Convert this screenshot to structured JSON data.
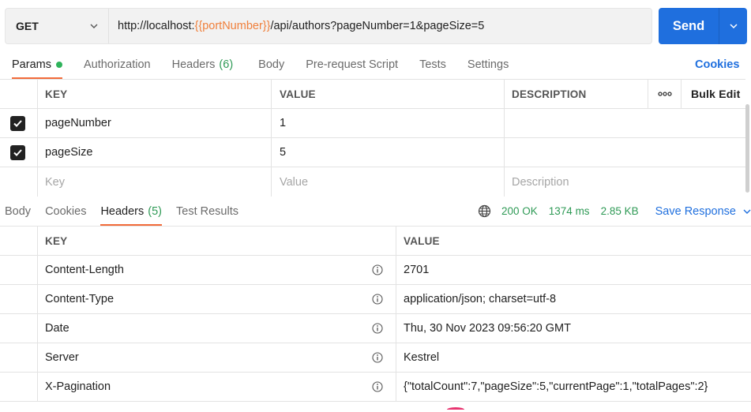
{
  "request": {
    "method": "GET",
    "url_prefix": "http://localhost:",
    "url_var": "{{portNumber}}",
    "url_suffix": "/api/authors?pageNumber=1&pageSize=5",
    "send_label": "Send"
  },
  "request_tabs": [
    {
      "label": "Params"
    },
    {
      "label": "Authorization"
    },
    {
      "label": "Headers",
      "count": "(6)"
    },
    {
      "label": "Body"
    },
    {
      "label": "Pre-request Script"
    },
    {
      "label": "Tests"
    },
    {
      "label": "Settings"
    }
  ],
  "cookies_label": "Cookies",
  "params": {
    "headers": {
      "key": "KEY",
      "value": "VALUE",
      "description": "DESCRIPTION",
      "bulk_edit": "Bulk Edit"
    },
    "rows": [
      {
        "key": "pageNumber",
        "value": "1",
        "checked": true
      },
      {
        "key": "pageSize",
        "value": "5",
        "checked": true
      }
    ],
    "placeholders": {
      "key": "Key",
      "value": "Value",
      "description": "Description"
    }
  },
  "response_tabs": [
    {
      "label": "Body"
    },
    {
      "label": "Cookies"
    },
    {
      "label": "Headers",
      "count": "(5)"
    },
    {
      "label": "Test Results"
    }
  ],
  "response_status": {
    "status": "200 OK",
    "time": "1374 ms",
    "size": "2.85 KB",
    "save_label": "Save Response"
  },
  "response_headers": {
    "columns": {
      "key": "KEY",
      "value": "VALUE"
    },
    "rows": [
      {
        "key": "Content-Length",
        "value": "2701"
      },
      {
        "key": "Content-Type",
        "value": "application/json; charset=utf-8"
      },
      {
        "key": "Date",
        "value": "Thu, 30 Nov 2023 09:56:20 GMT"
      },
      {
        "key": "Server",
        "value": "Kestrel"
      },
      {
        "key": "X-Pagination",
        "value": "{\"totalCount\":7,\"pageSize\":5,\"currentPage\":1,\"totalPages\":2}"
      }
    ]
  },
  "colors": {
    "accent": "#1f6fde",
    "tab_underline": "#f26b3a",
    "success": "#2f9a56",
    "url_variable": "#f0803c"
  }
}
